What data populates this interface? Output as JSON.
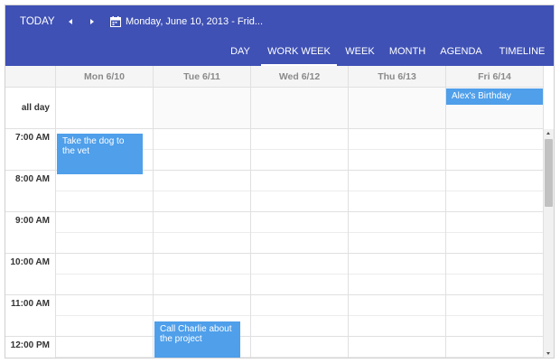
{
  "toolbar": {
    "today_label": "TODAY",
    "date_label": "Monday, June 10, 2013 - Frid...",
    "views": [
      "DAY",
      "WORK WEEK",
      "WEEK",
      "MONTH",
      "AGENDA",
      "TIMELINE"
    ],
    "selected_view": "WORK WEEK"
  },
  "days": [
    "Mon 6/10",
    "Tue 6/11",
    "Wed 6/12",
    "Thu 6/13",
    "Fri 6/14"
  ],
  "allday_label": "all day",
  "times": [
    "7:00 AM",
    "8:00 AM",
    "9:00 AM",
    "10:00 AM",
    "11:00 AM",
    "12:00 PM"
  ],
  "events": {
    "allday": {
      "title": "Alex's Birthday",
      "day": "Fri 6/14"
    },
    "timed": [
      {
        "title": "Take the dog to the vet",
        "day": "Mon 6/10",
        "start": "7:00 AM",
        "end": "8:00 AM"
      },
      {
        "title": "Call Charlie about the project",
        "day": "Tue 6/11",
        "start": "11:30 AM",
        "end": "12:30 PM"
      }
    ]
  },
  "colors": {
    "toolbar": "#3f51b5",
    "event": "#4f9fea"
  }
}
